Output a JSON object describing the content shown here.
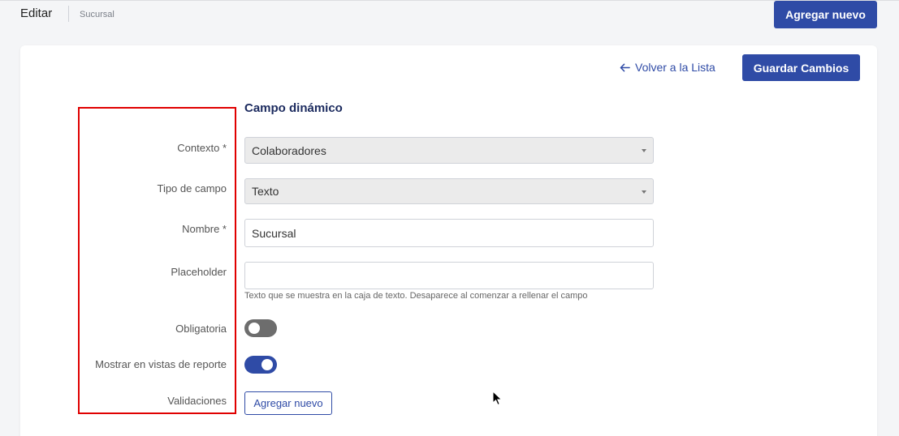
{
  "header": {
    "title": "Editar",
    "breadcrumb": "Sucursal",
    "add_button": "Agregar nuevo"
  },
  "toolbar": {
    "back_link": "Volver a la Lista",
    "save_button": "Guardar Cambios"
  },
  "form": {
    "section_title": "Campo dinámico",
    "contexto": {
      "label": "Contexto *",
      "value": "Colaboradores"
    },
    "tipo_campo": {
      "label": "Tipo de campo",
      "value": "Texto"
    },
    "nombre": {
      "label": "Nombre *",
      "value": "Sucursal"
    },
    "placeholder": {
      "label": "Placeholder",
      "value": "",
      "help": "Texto que se muestra en la caja de texto. Desaparece al comenzar a rellenar el campo"
    },
    "obligatoria": {
      "label": "Obligatoria",
      "on": false
    },
    "mostrar_reporte": {
      "label": "Mostrar en vistas de reporte",
      "on": true
    },
    "validaciones": {
      "label": "Validaciones",
      "button": "Agregar nuevo"
    }
  },
  "icons": {
    "back": "arrow-left-icon",
    "select_caret": "caret-down-icon",
    "cursor": "mouse-pointer-icon"
  },
  "colors": {
    "primary": "#2f4ba6",
    "highlight": "#e00000",
    "toggle_off": "#6d6d6d"
  }
}
